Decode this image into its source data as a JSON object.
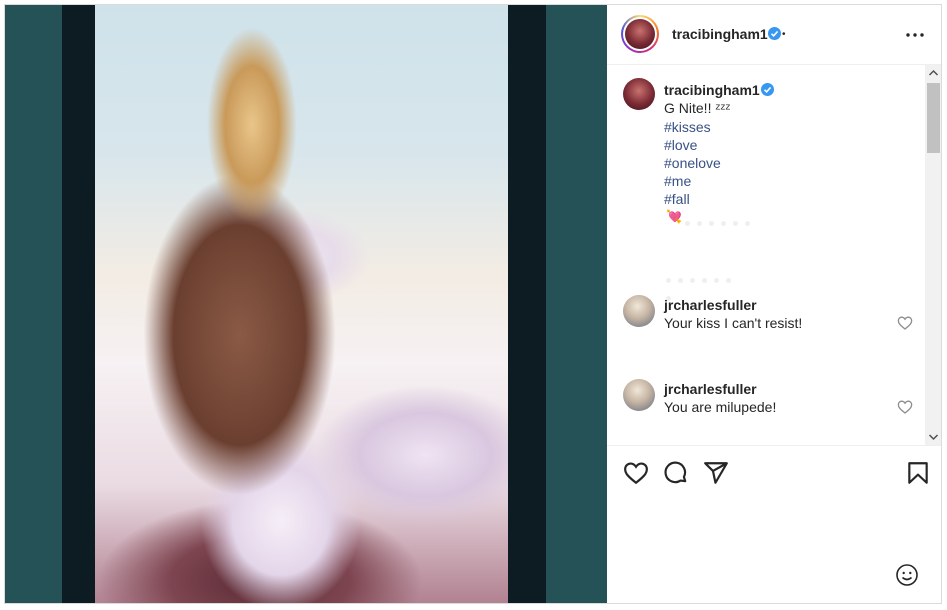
{
  "header": {
    "username": "tracibingham1",
    "dot": "•"
  },
  "caption": {
    "username": "tracibingham1",
    "text": "G Nite!! ᶻᶻᶻ",
    "hashtags": [
      "#kisses",
      "#love",
      "#onelove",
      "#me",
      "#fall"
    ],
    "emoji": "💘"
  },
  "comments": [
    {
      "username": "jrcharlesfuller",
      "text": "Your kiss I can't resist!"
    },
    {
      "username": "jrcharlesfuller",
      "text": "You are milupede!"
    }
  ],
  "icons": {
    "more": "more-options-icon",
    "like": "heart-icon",
    "comment": "comment-icon",
    "share": "paper-plane-icon",
    "save": "bookmark-icon",
    "emoji": "smiley-icon"
  },
  "colors": {
    "verified": "#3897f0",
    "hashtag": "#385185",
    "media_bg": "#255257"
  }
}
